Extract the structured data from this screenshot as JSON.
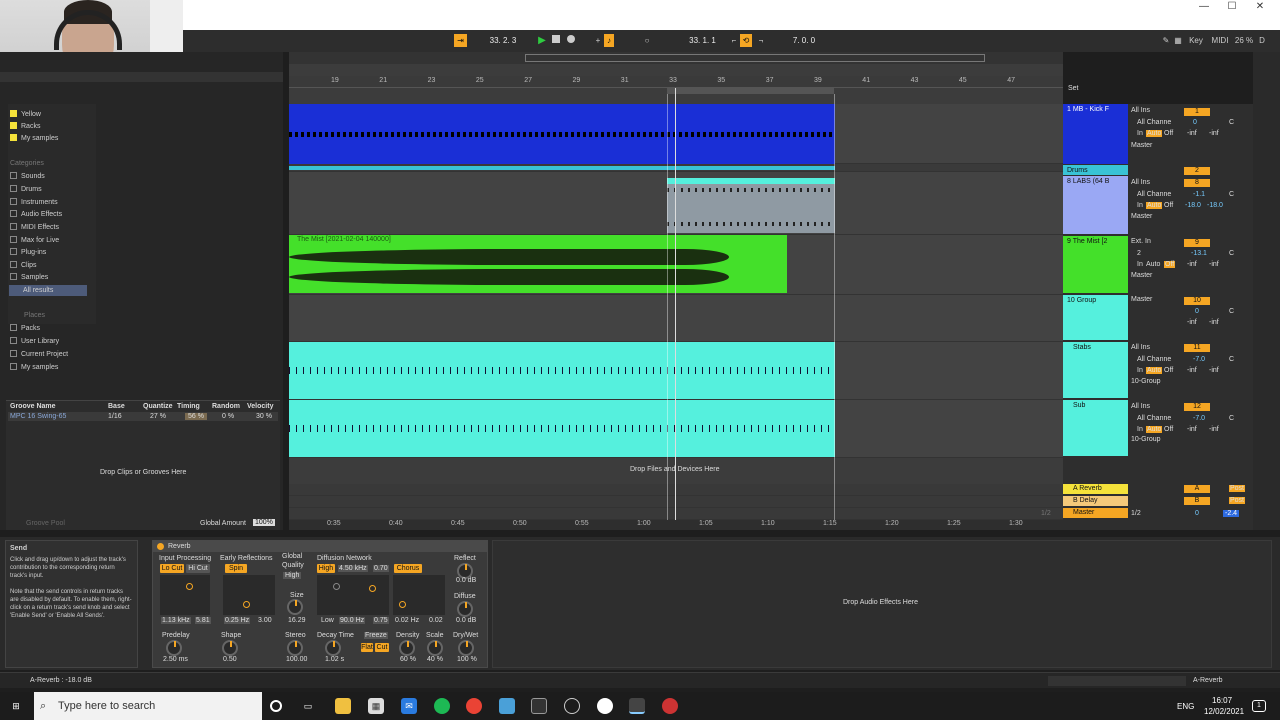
{
  "toolbar": {
    "position": "33.  2.  3",
    "loop_start": "33.  1.  1",
    "loop_length": "7.  0.  0",
    "key": "Key",
    "midi": "MIDI",
    "cpu": "26 %",
    "d": "D"
  },
  "ruler": {
    "bars": [
      "19",
      "21",
      "23",
      "25",
      "27",
      "29",
      "31",
      "33",
      "35",
      "37",
      "39",
      "41",
      "43",
      "45",
      "47"
    ],
    "times": [
      "0:35",
      "0:40",
      "0:45",
      "0:50",
      "0:55",
      "1:00",
      "1:05",
      "1:10",
      "1:15",
      "1:20",
      "1:25",
      "1:30"
    ],
    "set_label": "Set",
    "page": "1/2"
  },
  "browser": {
    "collections": [
      "Yellow",
      "Racks",
      "My samples"
    ],
    "categories_heading": "Categories",
    "categories": [
      "Sounds",
      "Drums",
      "Instruments",
      "Audio Effects",
      "MIDI Effects",
      "Max for Live",
      "Plug-ins",
      "Clips",
      "Samples",
      "All results"
    ],
    "places_heading": "Places",
    "places": [
      "Packs",
      "User Library",
      "Current Project",
      "My samples"
    ],
    "groove": {
      "headers": [
        "Groove Name",
        "Base",
        "Quantize",
        "Timing",
        "Random",
        "Velocity"
      ],
      "row": [
        "MPC 16 Swing-65",
        "1/16",
        "27 %",
        "56 %",
        "0 %",
        "30 %"
      ],
      "drop_text": "Drop Clips or Grooves Here",
      "pool_label": "Groove Pool",
      "global_amount_label": "Global Amount",
      "global_amount": "100%"
    }
  },
  "arrangement": {
    "audio_clip_name": "The Mist [2021-02-04 140000]",
    "drop_text": "Drop Files and Devices Here"
  },
  "tracks": [
    {
      "name": "1 MB - Kick F",
      "input": "All Ins",
      "channel": "All Channe",
      "out": "Master",
      "num": "1",
      "vol": "0",
      "pan": "C",
      "a": "-inf",
      "b": "-inf",
      "color": "#1a2fd6"
    },
    {
      "name": "Drums",
      "group": true,
      "num": "2",
      "color": "#39c3d6"
    },
    {
      "name": "8 LABS (64 B",
      "input": "All Ins",
      "channel": "All Channe",
      "out": "Master",
      "num": "8",
      "vol": "-1.1",
      "pan": "C",
      "a": "-18.0",
      "b": "-18.0",
      "color": "#9aa8f4"
    },
    {
      "name": "9 The Mist [2",
      "input": "Ext. In",
      "channel": "2",
      "out": "Master",
      "num": "9",
      "vol": "-13.1",
      "pan": "C",
      "a": "-inf",
      "b": "-inf",
      "color": "#44e02a"
    },
    {
      "name": "10 Group",
      "out": "Master",
      "num": "10",
      "vol": "0",
      "pan": "C",
      "a": "-inf",
      "b": "-inf",
      "color": "#55f0dd"
    },
    {
      "name": "Stabs",
      "input": "All Ins",
      "channel": "All Channe",
      "out": "10-Group",
      "num": "11",
      "vol": "-7.0",
      "pan": "C",
      "a": "-inf",
      "b": "-inf",
      "color": "#55f0dd"
    },
    {
      "name": "Sub",
      "input": "All Ins",
      "channel": "All Channe",
      "out": "10-Group",
      "num": "12",
      "vol": "-7.0",
      "pan": "C",
      "a": "-inf",
      "b": "-inf",
      "color": "#55f0dd"
    }
  ],
  "returns": [
    {
      "name": "A Reverb",
      "letter": "A",
      "post": "Post"
    },
    {
      "name": "B Delay",
      "letter": "B",
      "post": "Post"
    },
    {
      "name": "Master",
      "letter": "0",
      "vol": "-2.4",
      "out": "1/2"
    }
  ],
  "mixer_labels": {
    "in": "In",
    "auto": "Auto",
    "off": "Off"
  },
  "info": {
    "title": "Send",
    "p1": "Click and drag up/down to adjust the track's contribution to the corresponding return track's input.",
    "p2": "Note that the send controls in return tracks are disabled by default. To enable them, right-click on a return track's send knob and select 'Enable Send' or 'Enable All Sends'."
  },
  "reverb": {
    "title": "Reverb",
    "input_processing": "Input Processing",
    "lo_cut": "Lo Cut",
    "hi_cut": "Hi Cut",
    "freq1": "1.13 kHz",
    "freq2": "5.81",
    "early_reflections": "Early Reflections",
    "spin": "Spin",
    "spin_rate": "0.25 Hz",
    "spin_amt": "3.00",
    "global": "Global",
    "quality": "Quality",
    "quality_val": "High",
    "size_label": "Size",
    "size": "16.29",
    "diffusion_network": "Diffusion Network",
    "high": "High",
    "high_freq": "4.50 kHz",
    "high_amt": "0.70",
    "chorus": "Chorus",
    "low": "Low",
    "low_freq": "90.0 Hz",
    "low_amt": "0.75",
    "chorus_rate": "0.02 Hz",
    "chorus_amt": "0.02",
    "reflect": "Reflect",
    "reflect_val": "0.0 dB",
    "diffuse": "Diffuse",
    "diffuse_val": "0.0 dB",
    "predelay": "Predelay",
    "predelay_val": "2.50 ms",
    "shape": "Shape",
    "shape_val": "0.50",
    "stereo": "Stereo",
    "stereo_val": "100.00",
    "decay_time": "Decay Time",
    "decay_val": "1.02 s",
    "freeze": "Freeze",
    "flat": "Flat",
    "cut": "Cut",
    "density": "Density",
    "density_val": "60 %",
    "scale": "Scale",
    "scale_val": "40 %",
    "drywet": "Dry/Wet",
    "drywet_val": "100 %"
  },
  "drop_fx": "Drop Audio Effects Here",
  "status": {
    "left": "A-Reverb : -18.0 dB",
    "right": "A-Reverb"
  },
  "taskbar": {
    "search_placeholder": "Type here to search",
    "lang": "ENG",
    "time": "16:07",
    "date": "12/02/2021",
    "notif": "1"
  }
}
